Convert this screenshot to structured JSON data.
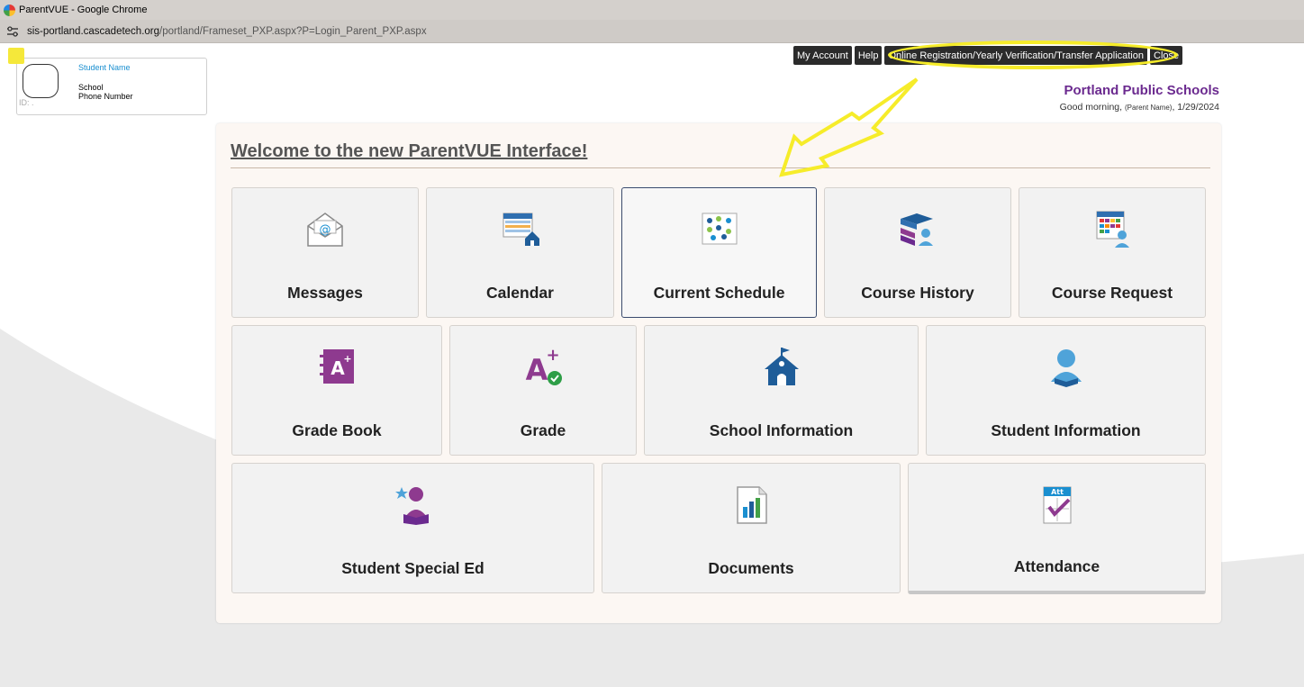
{
  "window": {
    "title": "ParentVUE - Google Chrome"
  },
  "browser": {
    "url_host": "sis-portland.cascadetech.org",
    "url_path": "/portland/Frameset_PXP.aspx?P=Login_Parent_PXP.aspx"
  },
  "student": {
    "name": "Student Name",
    "school": "School",
    "phone": "Phone Number",
    "id_label": "ID: ."
  },
  "topnav": {
    "my_account": "My Account",
    "help": "Help",
    "registration": "Online Registration/Yearly Verification/Transfer Application",
    "close": "Close"
  },
  "header": {
    "district": "Portland Public Schools",
    "greeting_prefix": "Good morning,",
    "parent_name": "(Parent Name)",
    "greeting_suffix": ", 1/29/2024"
  },
  "main": {
    "welcome": "Welcome to the new ParentVUE Interface!",
    "tiles": [
      {
        "label": "Messages",
        "icon": "envelope-icon"
      },
      {
        "label": "Calendar",
        "icon": "calendar-icon"
      },
      {
        "label": "Current Schedule",
        "icon": "schedule-icon"
      },
      {
        "label": "Course History",
        "icon": "books-icon"
      },
      {
        "label": "Course Request",
        "icon": "course-request-icon"
      },
      {
        "label": "Grade Book",
        "icon": "gradebook-icon"
      },
      {
        "label": "Grade",
        "icon": "grade-icon"
      },
      {
        "label": "School Information",
        "icon": "school-house-icon"
      },
      {
        "label": "Student Information",
        "icon": "student-icon"
      },
      {
        "label": "Student Special Ed",
        "icon": "special-ed-icon"
      },
      {
        "label": "Documents",
        "icon": "document-chart-icon"
      },
      {
        "label": "Attendance",
        "icon": "attendance-icon",
        "icon_text": "Att"
      }
    ]
  },
  "colors": {
    "district": "#6b2a8f",
    "highlight": "#f6ec2a",
    "student_name": "#1a8fd0"
  }
}
